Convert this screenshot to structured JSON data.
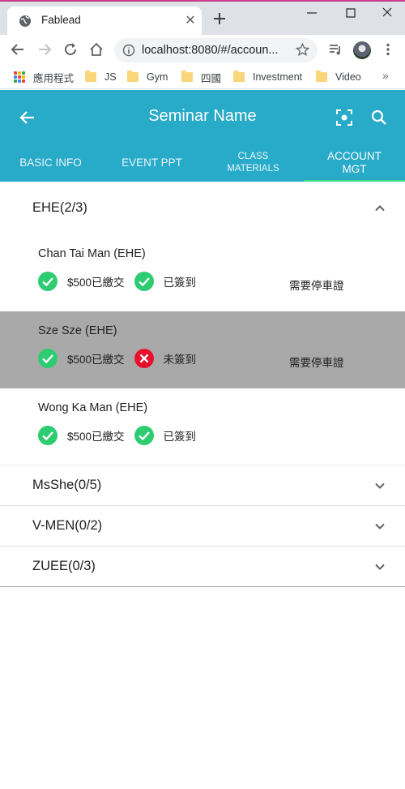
{
  "browser": {
    "tab_title": "Fablead",
    "url": "localhost:8080/#/accoun...",
    "bookmarks": [
      {
        "label": "應用程式",
        "icon": "apps-grid-icon"
      },
      {
        "label": "JS",
        "icon": "folder-icon"
      },
      {
        "label": "Gym",
        "icon": "folder-icon"
      },
      {
        "label": "四國",
        "icon": "folder-icon"
      },
      {
        "label": "Investment",
        "icon": "folder-icon"
      },
      {
        "label": "Video",
        "icon": "folder-icon"
      }
    ],
    "more_bookmarks": "»"
  },
  "header": {
    "title": "Seminar Name",
    "tabs": [
      {
        "label": "BASIC INFO"
      },
      {
        "label": "EVENT PPT"
      },
      {
        "label": "CLASS MATERIALS"
      },
      {
        "label": "ACCOUNT MGT"
      }
    ],
    "active_tab": "ACCOUNT MGT"
  },
  "groups": [
    {
      "label": "EHE(2/3)",
      "expanded": true,
      "members": [
        {
          "name": "Chan Tai Man (EHE)",
          "payment": "$500已繳交",
          "payment_ok": true,
          "checkin": "已簽到",
          "checkin_ok": true,
          "parking": "需要停車證",
          "selected": false
        },
        {
          "name": "Sze Sze (EHE)",
          "payment": "$500已繳交",
          "payment_ok": true,
          "checkin": "未簽到",
          "checkin_ok": false,
          "parking": "需要停車證",
          "selected": true
        },
        {
          "name": "Wong Ka Man (EHE)",
          "payment": "$500已繳交",
          "payment_ok": true,
          "checkin": "已簽到",
          "checkin_ok": true,
          "parking": "",
          "selected": false
        }
      ]
    },
    {
      "label": "MsShe(0/5)",
      "expanded": false
    },
    {
      "label": "V-MEN(0/2)",
      "expanded": false
    },
    {
      "label": "ZUEE(0/3)",
      "expanded": false
    }
  ],
  "colors": {
    "header_bg": "#28aac9",
    "active_tab_indicator": "#3ddc84",
    "status_ok": "#2ecc71",
    "status_fail": "#e8112d",
    "selected_row": "#a9a9a9"
  }
}
